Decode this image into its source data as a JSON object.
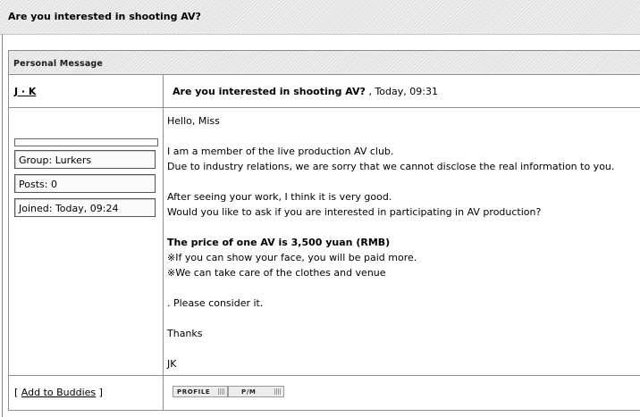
{
  "page": {
    "title": "Are you interested in shooting AV?"
  },
  "pm": {
    "header": "Personal Message",
    "author": "J · K",
    "subject": "Are you interested in shooting AV?",
    "date": " , Today, 09:31",
    "user_info": {
      "group": "Group: Lurkers",
      "posts": "Posts: 0",
      "joined": "Joined: Today, 09:24"
    },
    "body": {
      "greeting": "Hello, Miss",
      "line1": "I am a member of the live production AV club.",
      "line2": "Due to industry relations, we are sorry that we cannot disclose the real information to you.",
      "line3": "After seeing your work, I think it is very good.",
      "line4": "Would you like to ask if you are interested in participating in AV production?",
      "price": "The price of one AV is 3,500 yuan (RMB)",
      "note1": "※If you can show your face, you will be paid more.",
      "note2": "※We can take care of the clothes and venue",
      "consider": ". Please consider it.",
      "thanks": "Thanks",
      "signature": "JK"
    },
    "footer": {
      "buddy_prefix": "[ ",
      "buddy_link": "Add to Buddies",
      "buddy_suffix": " ]",
      "profile_btn": "PROFILE",
      "pm_btn": "P/M"
    }
  }
}
